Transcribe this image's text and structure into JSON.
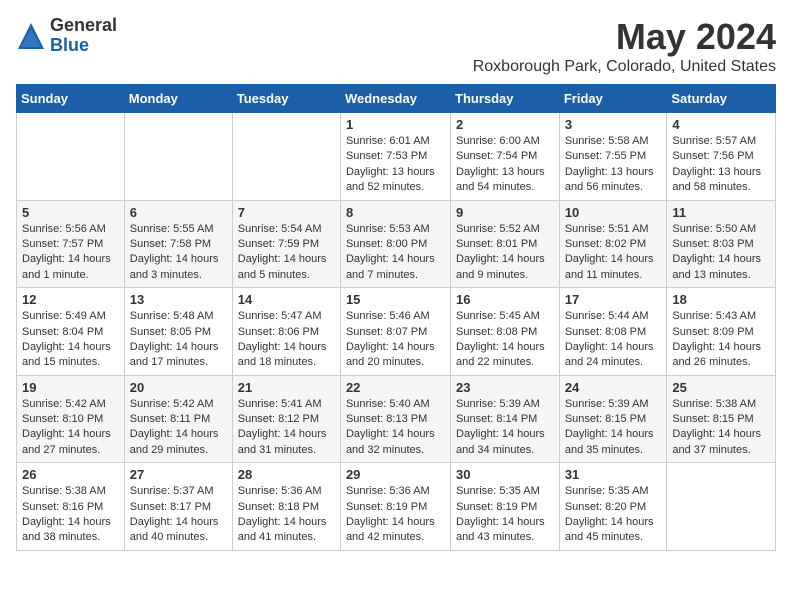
{
  "logo": {
    "general": "General",
    "blue": "Blue"
  },
  "title": "May 2024",
  "location": "Roxborough Park, Colorado, United States",
  "days_of_week": [
    "Sunday",
    "Monday",
    "Tuesday",
    "Wednesday",
    "Thursday",
    "Friday",
    "Saturday"
  ],
  "weeks": [
    [
      {
        "day": "",
        "info": ""
      },
      {
        "day": "",
        "info": ""
      },
      {
        "day": "",
        "info": ""
      },
      {
        "day": "1",
        "info": "Sunrise: 6:01 AM\nSunset: 7:53 PM\nDaylight: 13 hours\nand 52 minutes."
      },
      {
        "day": "2",
        "info": "Sunrise: 6:00 AM\nSunset: 7:54 PM\nDaylight: 13 hours\nand 54 minutes."
      },
      {
        "day": "3",
        "info": "Sunrise: 5:58 AM\nSunset: 7:55 PM\nDaylight: 13 hours\nand 56 minutes."
      },
      {
        "day": "4",
        "info": "Sunrise: 5:57 AM\nSunset: 7:56 PM\nDaylight: 13 hours\nand 58 minutes."
      }
    ],
    [
      {
        "day": "5",
        "info": "Sunrise: 5:56 AM\nSunset: 7:57 PM\nDaylight: 14 hours\nand 1 minute."
      },
      {
        "day": "6",
        "info": "Sunrise: 5:55 AM\nSunset: 7:58 PM\nDaylight: 14 hours\nand 3 minutes."
      },
      {
        "day": "7",
        "info": "Sunrise: 5:54 AM\nSunset: 7:59 PM\nDaylight: 14 hours\nand 5 minutes."
      },
      {
        "day": "8",
        "info": "Sunrise: 5:53 AM\nSunset: 8:00 PM\nDaylight: 14 hours\nand 7 minutes."
      },
      {
        "day": "9",
        "info": "Sunrise: 5:52 AM\nSunset: 8:01 PM\nDaylight: 14 hours\nand 9 minutes."
      },
      {
        "day": "10",
        "info": "Sunrise: 5:51 AM\nSunset: 8:02 PM\nDaylight: 14 hours\nand 11 minutes."
      },
      {
        "day": "11",
        "info": "Sunrise: 5:50 AM\nSunset: 8:03 PM\nDaylight: 14 hours\nand 13 minutes."
      }
    ],
    [
      {
        "day": "12",
        "info": "Sunrise: 5:49 AM\nSunset: 8:04 PM\nDaylight: 14 hours\nand 15 minutes."
      },
      {
        "day": "13",
        "info": "Sunrise: 5:48 AM\nSunset: 8:05 PM\nDaylight: 14 hours\nand 17 minutes."
      },
      {
        "day": "14",
        "info": "Sunrise: 5:47 AM\nSunset: 8:06 PM\nDaylight: 14 hours\nand 18 minutes."
      },
      {
        "day": "15",
        "info": "Sunrise: 5:46 AM\nSunset: 8:07 PM\nDaylight: 14 hours\nand 20 minutes."
      },
      {
        "day": "16",
        "info": "Sunrise: 5:45 AM\nSunset: 8:08 PM\nDaylight: 14 hours\nand 22 minutes."
      },
      {
        "day": "17",
        "info": "Sunrise: 5:44 AM\nSunset: 8:08 PM\nDaylight: 14 hours\nand 24 minutes."
      },
      {
        "day": "18",
        "info": "Sunrise: 5:43 AM\nSunset: 8:09 PM\nDaylight: 14 hours\nand 26 minutes."
      }
    ],
    [
      {
        "day": "19",
        "info": "Sunrise: 5:42 AM\nSunset: 8:10 PM\nDaylight: 14 hours\nand 27 minutes."
      },
      {
        "day": "20",
        "info": "Sunrise: 5:42 AM\nSunset: 8:11 PM\nDaylight: 14 hours\nand 29 minutes."
      },
      {
        "day": "21",
        "info": "Sunrise: 5:41 AM\nSunset: 8:12 PM\nDaylight: 14 hours\nand 31 minutes."
      },
      {
        "day": "22",
        "info": "Sunrise: 5:40 AM\nSunset: 8:13 PM\nDaylight: 14 hours\nand 32 minutes."
      },
      {
        "day": "23",
        "info": "Sunrise: 5:39 AM\nSunset: 8:14 PM\nDaylight: 14 hours\nand 34 minutes."
      },
      {
        "day": "24",
        "info": "Sunrise: 5:39 AM\nSunset: 8:15 PM\nDaylight: 14 hours\nand 35 minutes."
      },
      {
        "day": "25",
        "info": "Sunrise: 5:38 AM\nSunset: 8:15 PM\nDaylight: 14 hours\nand 37 minutes."
      }
    ],
    [
      {
        "day": "26",
        "info": "Sunrise: 5:38 AM\nSunset: 8:16 PM\nDaylight: 14 hours\nand 38 minutes."
      },
      {
        "day": "27",
        "info": "Sunrise: 5:37 AM\nSunset: 8:17 PM\nDaylight: 14 hours\nand 40 minutes."
      },
      {
        "day": "28",
        "info": "Sunrise: 5:36 AM\nSunset: 8:18 PM\nDaylight: 14 hours\nand 41 minutes."
      },
      {
        "day": "29",
        "info": "Sunrise: 5:36 AM\nSunset: 8:19 PM\nDaylight: 14 hours\nand 42 minutes."
      },
      {
        "day": "30",
        "info": "Sunrise: 5:35 AM\nSunset: 8:19 PM\nDaylight: 14 hours\nand 43 minutes."
      },
      {
        "day": "31",
        "info": "Sunrise: 5:35 AM\nSunset: 8:20 PM\nDaylight: 14 hours\nand 45 minutes."
      },
      {
        "day": "",
        "info": ""
      }
    ]
  ]
}
